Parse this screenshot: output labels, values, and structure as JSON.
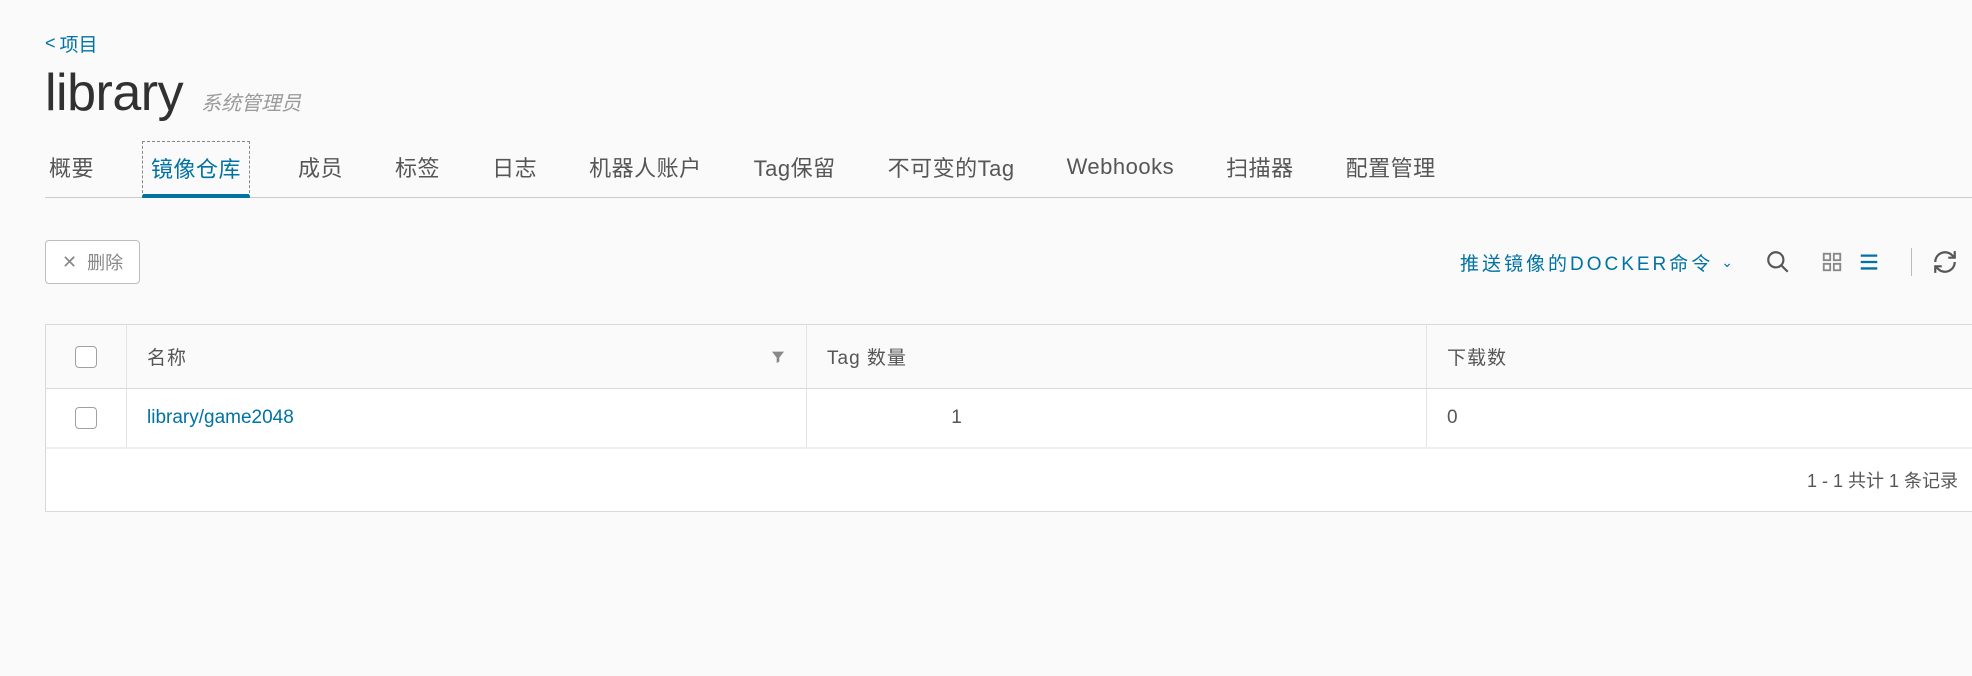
{
  "breadcrumb": {
    "back_label": "项目"
  },
  "header": {
    "title": "library",
    "subtitle": "系统管理员"
  },
  "tabs": [
    {
      "label": "概要"
    },
    {
      "label": "镜像仓库",
      "active": true
    },
    {
      "label": "成员"
    },
    {
      "label": "标签"
    },
    {
      "label": "日志"
    },
    {
      "label": "机器人账户"
    },
    {
      "label": "Tag保留"
    },
    {
      "label": "不可变的Tag"
    },
    {
      "label": "Webhooks"
    },
    {
      "label": "扫描器"
    },
    {
      "label": "配置管理"
    }
  ],
  "actions": {
    "delete_label": "删除",
    "push_cmd_label": "推送镜像的DOCKER命令"
  },
  "table": {
    "columns": {
      "name": "名称",
      "tags": "Tag 数量",
      "downloads": "下载数"
    },
    "rows": [
      {
        "name": "library/game2048",
        "tags": "1",
        "downloads": "0"
      }
    ],
    "pagination": "1 - 1 共计 1 条记录"
  }
}
